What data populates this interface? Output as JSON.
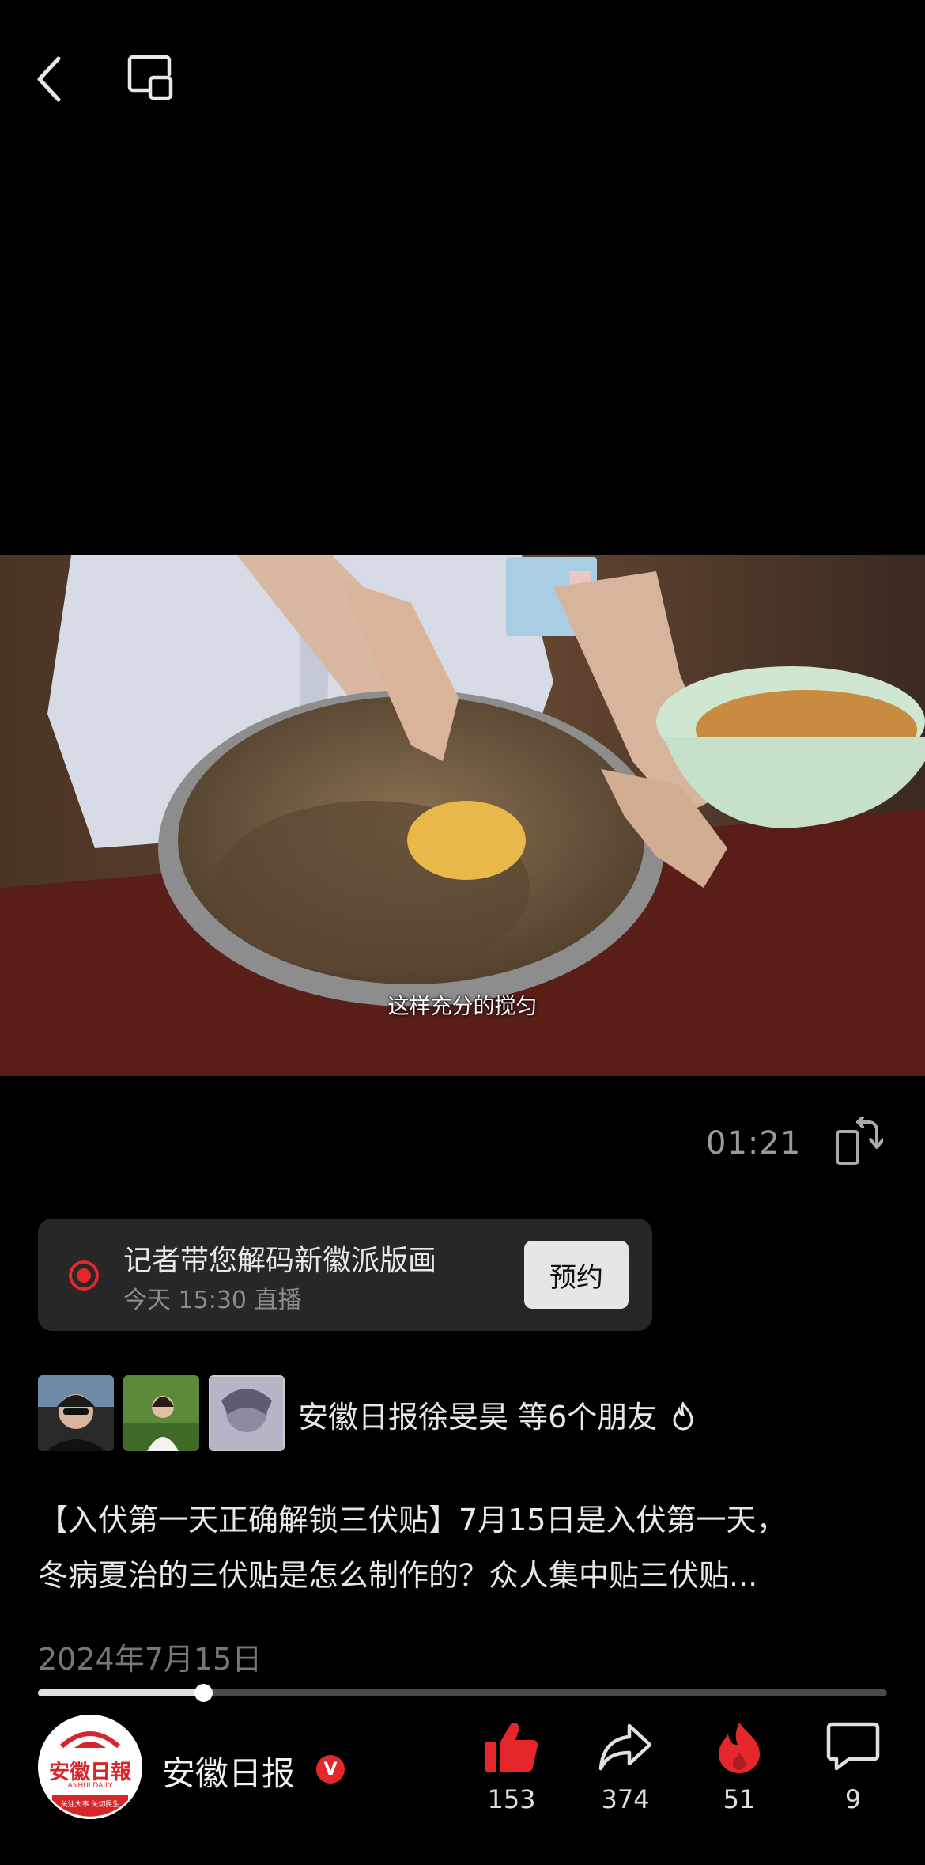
{
  "video": {
    "subtitle": "这样充分的搅匀",
    "time": "01:21"
  },
  "live": {
    "title": "记者带您解码新徽派版画",
    "subtitle": "今天 15:30 直播",
    "reserve_label": "预约"
  },
  "friends": {
    "text": "安徽日报徐旻昊 等6个朋友"
  },
  "description": {
    "line1": "【入伏第一天正确解锁三伏贴】7月15日是入伏第一天，",
    "line2": "冬病夏治的三伏贴是怎么制作的？众人集中贴三伏贴..."
  },
  "date": "2024年7月15日",
  "progress": {
    "fraction": 0.195
  },
  "author": {
    "name": "安徽日报",
    "badge": "V",
    "logo_text": "安徽日報",
    "logo_sub": "ANHUI DAILY",
    "logo_slogan": "关注大事 关切民生"
  },
  "actions": {
    "like_count": "153",
    "share_count": "374",
    "hot_count": "51",
    "comment_count": "9"
  },
  "colors": {
    "accent_red": "#e5262a",
    "background": "#000000",
    "card": "#272727"
  },
  "icons": {
    "back": "chevron-left-icon",
    "pip": "picture-in-picture-icon",
    "rotate": "rotate-screen-icon",
    "live": "live-record-icon",
    "like": "thumbs-up-icon",
    "share": "share-arrow-icon",
    "hot": "flame-icon",
    "comment": "comment-bubble-icon"
  }
}
